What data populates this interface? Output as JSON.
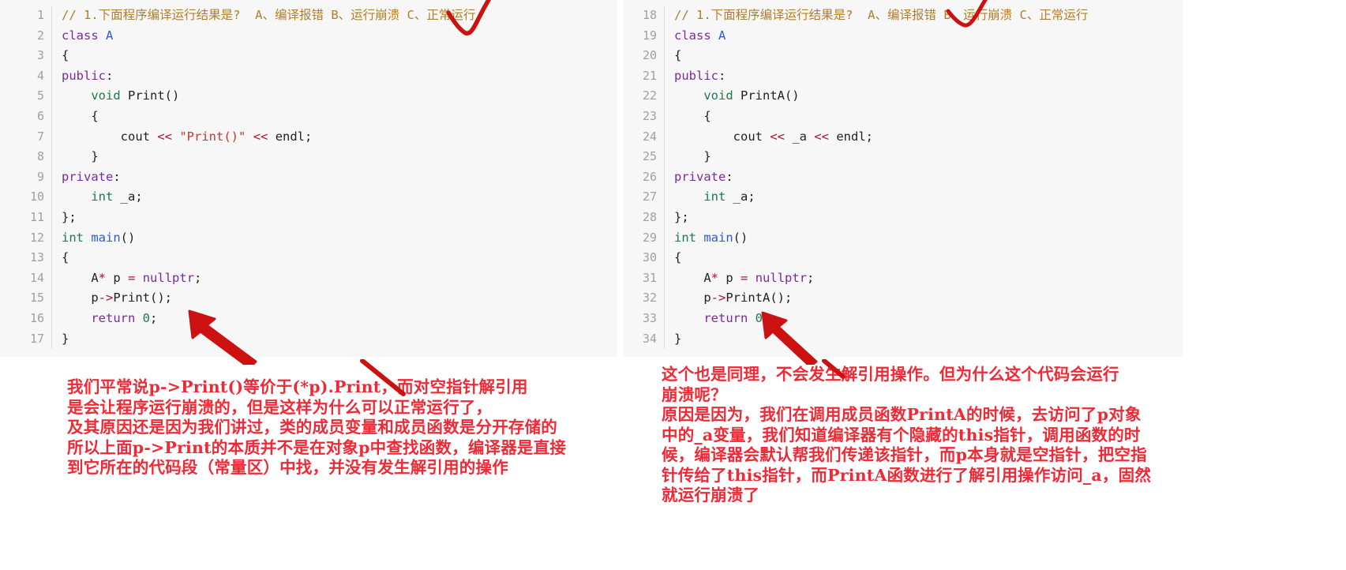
{
  "colors": {
    "panel_background": "#f7f7f7",
    "page_background": "#ffffff",
    "annotation_red": "#ef2a36",
    "mark_red": "#cc1111",
    "gutter_text": "#a0a0a0",
    "comment": "#b07d2a",
    "keyword": "#7a2a9e",
    "type": "#1a7a4c",
    "class_name": "#2a5ad6",
    "string": "#c0392b",
    "operator": "#b01030"
  },
  "left_panel": {
    "first_line_number": 1,
    "lines": [
      {
        "n": "1",
        "tokens": [
          {
            "t": "// 1.下面程序编译运行结果是?  A、编译报错 B、运行崩溃 C、正常运行",
            "c": "t-comment"
          }
        ]
      },
      {
        "n": "2",
        "tokens": [
          {
            "t": "class ",
            "c": "t-kw"
          },
          {
            "t": "A",
            "c": "t-cls"
          }
        ]
      },
      {
        "n": "3",
        "tokens": [
          {
            "t": "{",
            "c": "t-plain"
          }
        ]
      },
      {
        "n": "4",
        "tokens": [
          {
            "t": "public",
            "c": "t-kw"
          },
          {
            "t": ":",
            "c": "t-plain"
          }
        ]
      },
      {
        "n": "5",
        "tokens": [
          {
            "t": "    ",
            "c": "t-plain"
          },
          {
            "t": "void",
            "c": "t-type"
          },
          {
            "t": " Print()",
            "c": "t-plain"
          }
        ]
      },
      {
        "n": "6",
        "tokens": [
          {
            "t": "    {",
            "c": "t-plain"
          }
        ]
      },
      {
        "n": "7",
        "tokens": [
          {
            "t": "        cout ",
            "c": "t-plain"
          },
          {
            "t": "<<",
            "c": "t-op"
          },
          {
            "t": " ",
            "c": "t-plain"
          },
          {
            "t": "\"Print()\"",
            "c": "t-str"
          },
          {
            "t": " ",
            "c": "t-plain"
          },
          {
            "t": "<<",
            "c": "t-op"
          },
          {
            "t": " endl;",
            "c": "t-plain"
          }
        ]
      },
      {
        "n": "8",
        "tokens": [
          {
            "t": "    }",
            "c": "t-plain"
          }
        ]
      },
      {
        "n": "9",
        "tokens": [
          {
            "t": "private",
            "c": "t-kw"
          },
          {
            "t": ":",
            "c": "t-plain"
          }
        ]
      },
      {
        "n": "10",
        "tokens": [
          {
            "t": "    ",
            "c": "t-plain"
          },
          {
            "t": "int",
            "c": "t-type"
          },
          {
            "t": " _a;",
            "c": "t-plain"
          }
        ]
      },
      {
        "n": "11",
        "tokens": [
          {
            "t": "};",
            "c": "t-plain"
          }
        ]
      },
      {
        "n": "12",
        "tokens": [
          {
            "t": "int",
            "c": "t-type"
          },
          {
            "t": " ",
            "c": "t-plain"
          },
          {
            "t": "main",
            "c": "t-fn"
          },
          {
            "t": "()",
            "c": "t-plain"
          }
        ]
      },
      {
        "n": "13",
        "tokens": [
          {
            "t": "{",
            "c": "t-plain"
          }
        ]
      },
      {
        "n": "14",
        "tokens": [
          {
            "t": "    A",
            "c": "t-plain"
          },
          {
            "t": "*",
            "c": "t-op"
          },
          {
            "t": " p ",
            "c": "t-plain"
          },
          {
            "t": "=",
            "c": "t-op"
          },
          {
            "t": " ",
            "c": "t-plain"
          },
          {
            "t": "nullptr",
            "c": "t-kw"
          },
          {
            "t": ";",
            "c": "t-plain"
          }
        ]
      },
      {
        "n": "15",
        "tokens": [
          {
            "t": "    p",
            "c": "t-plain"
          },
          {
            "t": "->",
            "c": "t-op"
          },
          {
            "t": "Print();",
            "c": "t-plain"
          }
        ]
      },
      {
        "n": "16",
        "tokens": [
          {
            "t": "    ",
            "c": "t-plain"
          },
          {
            "t": "return",
            "c": "t-kw"
          },
          {
            "t": " ",
            "c": "t-plain"
          },
          {
            "t": "0",
            "c": "t-num"
          },
          {
            "t": ";",
            "c": "t-plain"
          }
        ]
      },
      {
        "n": "17",
        "tokens": [
          {
            "t": "}",
            "c": "t-plain"
          }
        ]
      }
    ]
  },
  "right_panel": {
    "first_line_number": 18,
    "lines": [
      {
        "n": "18",
        "tokens": [
          {
            "t": "// 1.下面程序编译运行结果是?  A、编译报错 B、运行崩溃 C、正常运行",
            "c": "t-comment"
          }
        ]
      },
      {
        "n": "19",
        "tokens": [
          {
            "t": "class ",
            "c": "t-kw"
          },
          {
            "t": "A",
            "c": "t-cls"
          }
        ]
      },
      {
        "n": "20",
        "tokens": [
          {
            "t": "{",
            "c": "t-plain"
          }
        ]
      },
      {
        "n": "21",
        "tokens": [
          {
            "t": "public",
            "c": "t-kw"
          },
          {
            "t": ":",
            "c": "t-plain"
          }
        ]
      },
      {
        "n": "22",
        "tokens": [
          {
            "t": "    ",
            "c": "t-plain"
          },
          {
            "t": "void",
            "c": "t-type"
          },
          {
            "t": " PrintA()",
            "c": "t-plain"
          }
        ]
      },
      {
        "n": "23",
        "tokens": [
          {
            "t": "    {",
            "c": "t-plain"
          }
        ]
      },
      {
        "n": "24",
        "tokens": [
          {
            "t": "        cout ",
            "c": "t-plain"
          },
          {
            "t": "<<",
            "c": "t-op"
          },
          {
            "t": " _a ",
            "c": "t-plain"
          },
          {
            "t": "<<",
            "c": "t-op"
          },
          {
            "t": " endl;",
            "c": "t-plain"
          }
        ]
      },
      {
        "n": "25",
        "tokens": [
          {
            "t": "    }",
            "c": "t-plain"
          }
        ]
      },
      {
        "n": "26",
        "tokens": [
          {
            "t": "private",
            "c": "t-kw"
          },
          {
            "t": ":",
            "c": "t-plain"
          }
        ]
      },
      {
        "n": "27",
        "tokens": [
          {
            "t": "    ",
            "c": "t-plain"
          },
          {
            "t": "int",
            "c": "t-type"
          },
          {
            "t": " _a;",
            "c": "t-plain"
          }
        ]
      },
      {
        "n": "28",
        "tokens": [
          {
            "t": "};",
            "c": "t-plain"
          }
        ]
      },
      {
        "n": "29",
        "tokens": [
          {
            "t": "int",
            "c": "t-type"
          },
          {
            "t": " ",
            "c": "t-plain"
          },
          {
            "t": "main",
            "c": "t-fn"
          },
          {
            "t": "()",
            "c": "t-plain"
          }
        ]
      },
      {
        "n": "30",
        "tokens": [
          {
            "t": "{",
            "c": "t-plain"
          }
        ]
      },
      {
        "n": "31",
        "tokens": [
          {
            "t": "    A",
            "c": "t-plain"
          },
          {
            "t": "*",
            "c": "t-op"
          },
          {
            "t": " p ",
            "c": "t-plain"
          },
          {
            "t": "=",
            "c": "t-op"
          },
          {
            "t": " ",
            "c": "t-plain"
          },
          {
            "t": "nullptr",
            "c": "t-kw"
          },
          {
            "t": ";",
            "c": "t-plain"
          }
        ]
      },
      {
        "n": "32",
        "tokens": [
          {
            "t": "    p",
            "c": "t-plain"
          },
          {
            "t": "->",
            "c": "t-op"
          },
          {
            "t": "PrintA();",
            "c": "t-plain"
          }
        ]
      },
      {
        "n": "33",
        "tokens": [
          {
            "t": "    ",
            "c": "t-plain"
          },
          {
            "t": "return",
            "c": "t-kw"
          },
          {
            "t": " ",
            "c": "t-plain"
          },
          {
            "t": "0",
            "c": "t-num"
          },
          {
            "t": ";",
            "c": "t-plain"
          }
        ]
      },
      {
        "n": "34",
        "tokens": [
          {
            "t": "}",
            "c": "t-plain"
          }
        ]
      }
    ]
  },
  "annotations": {
    "left_note": "我们平常说p->Print()等价于(*p).Print，而对空指针解引用\n是会让程序运行崩溃的，但是这样为什么可以正常运行了，\n及其原因还是因为我们讲过，类的成员变量和成员函数是分开存储的\n所以上面p->Print的本质并不是在对象p中查找函数，编译器是直接\n到它所在的代码段（常量区）中找，并没有发生解引用的操作",
    "right_note": "这个也是同理，不会发生解引用操作。但为什么这个代码会运行\n崩溃呢？\n原因是因为，我们在调用成员函数PrintA的时候，去访问了p对象\n中的_a变量，我们知道编译器有个隐藏的this指针，调用函数的时\n候，编译器会默认帮我们传递该指针，而p本身就是空指针，把空指\n针传给了this指针，而PrintA函数进行了解引用操作访问_a，固然\n就运行崩溃了"
  },
  "marks": {
    "left_check": "red-check-mark",
    "right_check": "red-check-mark",
    "left_arrow": "red-arrow-up-left",
    "right_arrow": "red-arrow-up-left",
    "left_slash": "red-slash-stroke",
    "right_slash": "red-slash-stroke"
  }
}
